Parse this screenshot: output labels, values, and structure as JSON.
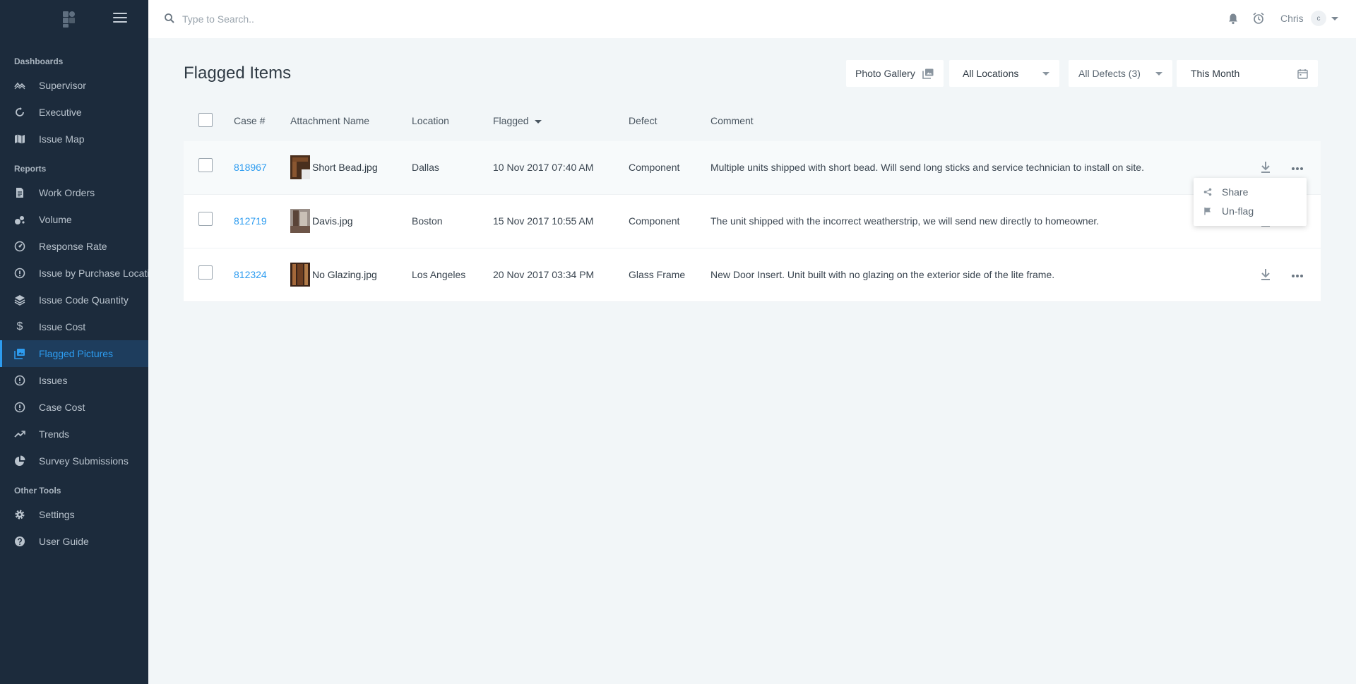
{
  "sidebar": {
    "sections": [
      {
        "title": "Dashboards",
        "items": [
          {
            "label": "Supervisor",
            "icon": "wave-chart-icon"
          },
          {
            "label": "Executive",
            "icon": "circle-arrows-icon"
          },
          {
            "label": "Issue Map",
            "icon": "map-icon"
          }
        ]
      },
      {
        "title": "Reports",
        "items": [
          {
            "label": "Work Orders",
            "icon": "document-icon"
          },
          {
            "label": "Volume",
            "icon": "bubbles-icon"
          },
          {
            "label": "Response Rate",
            "icon": "speedometer-icon"
          },
          {
            "label": "Issue by Purchase Location",
            "icon": "alert-circle-icon"
          },
          {
            "label": "Issue Code Quantity",
            "icon": "layers-icon"
          },
          {
            "label": "Issue Cost",
            "icon": "dollar-icon"
          },
          {
            "label": "Flagged Pictures",
            "icon": "gallery-icon",
            "active": true
          },
          {
            "label": "Issues",
            "icon": "alert-circle-icon"
          },
          {
            "label": "Case Cost",
            "icon": "alert-circle-icon"
          },
          {
            "label": "Trends",
            "icon": "trending-up-icon"
          },
          {
            "label": "Survey Submissions",
            "icon": "pie-chart-icon"
          }
        ]
      },
      {
        "title": "Other Tools",
        "items": [
          {
            "label": "Settings",
            "icon": "gear-icon"
          },
          {
            "label": "User Guide",
            "icon": "help-circle-icon"
          }
        ]
      }
    ]
  },
  "topbar": {
    "search_placeholder": "Type to Search..",
    "username": "Chris",
    "avatar_initial": "c"
  },
  "page": {
    "title": "Flagged Items",
    "filters": {
      "gallery": "Photo Gallery",
      "location": "All Locations",
      "defects": "All Defects (3)",
      "date": "This Month"
    }
  },
  "table": {
    "headers": {
      "case": "Case #",
      "attachment": "Attachment Name",
      "location": "Location",
      "flagged": "Flagged",
      "defect": "Defect",
      "comment": "Comment"
    },
    "rows": [
      {
        "case": "818967",
        "attachment": "Short Bead.jpg",
        "location": "Dallas",
        "flagged": "10 Nov 2017 07:40 AM",
        "defect": "Component",
        "comment": "Multiple units shipped with short bead. Will send long sticks and service technician to install on site."
      },
      {
        "case": "812719",
        "attachment": "Davis.jpg",
        "location": "Boston",
        "flagged": "15 Nov 2017 10:55 AM",
        "defect": "Component",
        "comment": "The unit shipped with the incorrect weatherstrip, we will send new directly to homeowner."
      },
      {
        "case": "812324",
        "attachment": "No Glazing.jpg",
        "location": "Los Angeles",
        "flagged": "20 Nov 2017 03:34 PM",
        "defect": "Glass Frame",
        "comment": "New Door Insert. Unit built with no glazing on the exterior side of the lite frame."
      }
    ]
  },
  "row_menu": {
    "share": "Share",
    "unflag": "Un-flag"
  },
  "colors": {
    "sidebar_bg": "#1c2b3c",
    "accent": "#2d9cf0",
    "page_bg": "#f2f6f8"
  }
}
